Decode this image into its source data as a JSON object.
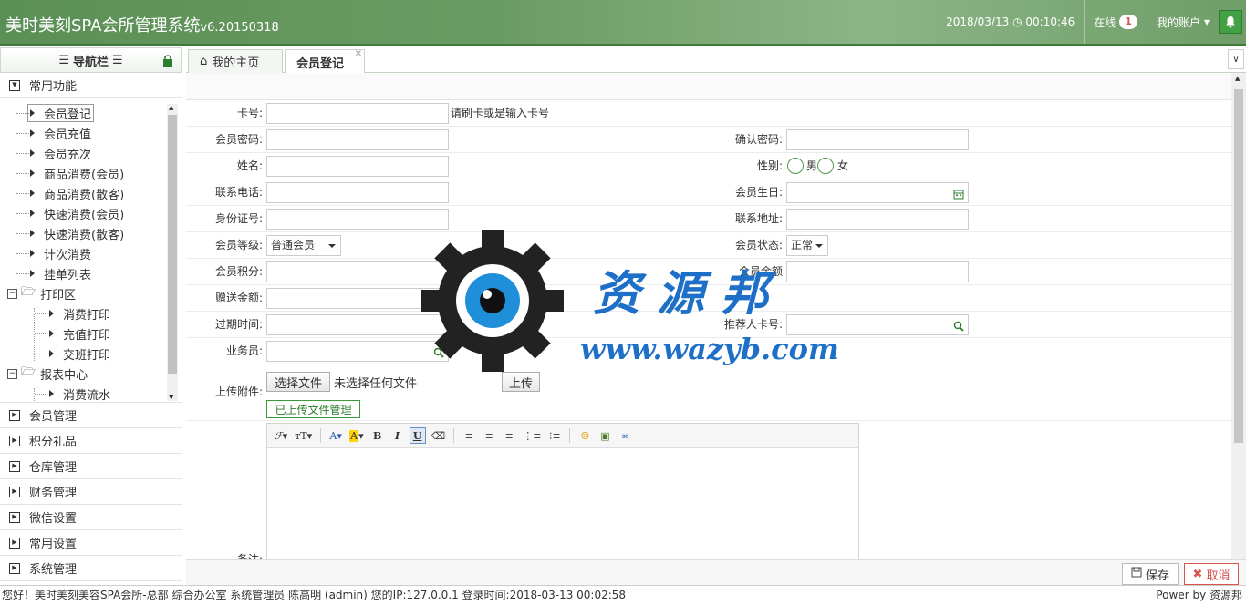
{
  "app": {
    "title": "美时美刻SPA会所管理系统",
    "version": "v6.20150318",
    "datetime": "2018/03/13",
    "time": "00:10:46",
    "online_label": "在线",
    "online_count": "1",
    "account_label": "我的账户"
  },
  "sidebar": {
    "header": "导航栏",
    "common_section": "常用功能",
    "tree": [
      {
        "label": "会员登记"
      },
      {
        "label": "会员充值"
      },
      {
        "label": "会员充次"
      },
      {
        "label": "商品消费(会员)"
      },
      {
        "label": "商品消费(散客)"
      },
      {
        "label": "快速消费(会员)"
      },
      {
        "label": "快速消费(散客)"
      },
      {
        "label": "计次消费"
      },
      {
        "label": "挂单列表"
      }
    ],
    "print_folder": "打印区",
    "print_items": [
      "消费打印",
      "充值打印",
      "交班打印"
    ],
    "report_folder": "报表中心",
    "report_items": [
      "消费流水"
    ],
    "sections": [
      "会员管理",
      "积分礼品",
      "仓库管理",
      "财务管理",
      "微信设置",
      "常用设置",
      "系统管理"
    ]
  },
  "tabs": {
    "home": "我的主页",
    "register": "会员登记"
  },
  "form": {
    "card_no": "卡号:",
    "card_hint": "请刷卡或是输入卡号",
    "password": "会员密码:",
    "confirm_password": "确认密码:",
    "name": "姓名:",
    "gender": "性别:",
    "male": "男",
    "female": "女",
    "phone": "联系电话:",
    "birthday": "会员生日:",
    "id_card": "身份证号:",
    "address": "联系地址:",
    "level": "会员等级:",
    "level_value": "普通会员",
    "status": "会员状态:",
    "status_value": "正常",
    "points": "会员积分:",
    "balance": "会员余额",
    "gift_amount": "赠送金额:",
    "expire": "过期时间:",
    "referrer": "推荐人卡号:",
    "salesman": "业务员:",
    "attachment": "上传附件:",
    "choose_file": "选择文件",
    "no_file": "未选择任何文件",
    "upload": "上传",
    "uploaded_mgmt": "已上传文件管理",
    "remark": "备注:"
  },
  "actions": {
    "save": "保存",
    "cancel": "取消"
  },
  "status": {
    "text": "您好！美时美刻美容SPA会所-总部 综合办公室 系统管理员 陈高明 (admin) 您的IP:127.0.0.1 登录时间:2018-03-13 00:02:58",
    "power": "Power by 资源邦"
  },
  "watermark": {
    "cn": "资 源 邦",
    "url": "www.wazyb.com"
  },
  "colors": {
    "header_green": "#5a8f55",
    "accent_green": "#44a044",
    "cancel_red": "#d9534f"
  }
}
